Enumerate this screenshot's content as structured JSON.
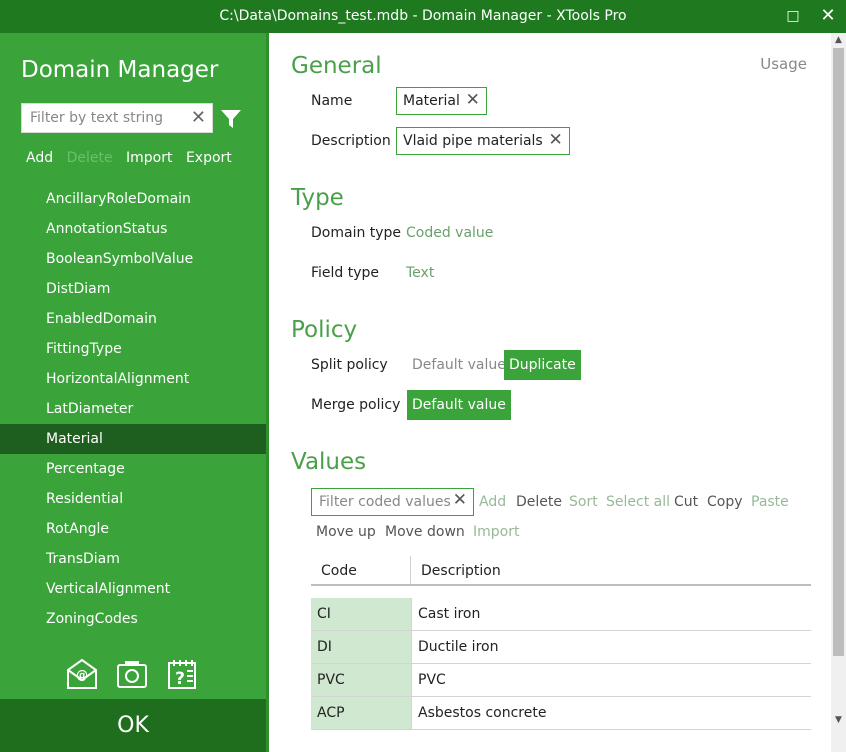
{
  "window": {
    "title": "C:\\Data\\Domains_test.mdb - Domain Manager - XTools Pro",
    "maximize_glyph": "□",
    "close_glyph": "✕"
  },
  "sidebar": {
    "heading": "Domain Manager",
    "filter_placeholder": "Filter by text string",
    "clear_glyph": "✕",
    "actions": {
      "add": "Add",
      "delete": "Delete",
      "import": "Import",
      "export": "Export"
    },
    "domains": [
      "AncillaryRoleDomain",
      "AnnotationStatus",
      "BooleanSymbolValue",
      "DistDiam",
      "EnabledDomain",
      "FittingType",
      "HorizontalAlignment",
      "LatDiameter",
      "Material",
      "Percentage",
      "Residential",
      "RotAngle",
      "TransDiam",
      "VerticalAlignment",
      "ZoningCodes"
    ],
    "selected_domain": "Material",
    "ok_label": "OK"
  },
  "main": {
    "usage_link": "Usage",
    "general": {
      "title": "General",
      "name_label": "Name",
      "name_value": "Material",
      "description_label": "Description",
      "description_value": "Vlaid pipe materials",
      "clear_glyph": "✕"
    },
    "type": {
      "title": "Type",
      "domain_type_label": "Domain type",
      "domain_type_value": "Coded value",
      "field_type_label": "Field type",
      "field_type_value": "Text"
    },
    "policy": {
      "title": "Policy",
      "split_label": "Split policy",
      "split_options": [
        "Default value",
        "Duplicate"
      ],
      "split_selected": "Duplicate",
      "merge_label": "Merge policy",
      "merge_options": [
        "Default value"
      ],
      "merge_selected": "Default value"
    },
    "values": {
      "title": "Values",
      "filter_placeholder": "Filter coded values",
      "actions": {
        "add": "Add",
        "delete": "Delete",
        "sort": "Sort",
        "select_all": "Select all",
        "cut": "Cut",
        "copy": "Copy",
        "paste": "Paste",
        "move_up": "Move up",
        "move_down": "Move down",
        "import": "Import"
      },
      "columns": [
        "Code",
        "Description"
      ],
      "rows": [
        {
          "code": "CI",
          "description": "Cast iron"
        },
        {
          "code": "DI",
          "description": "Ductile iron"
        },
        {
          "code": "PVC",
          "description": "PVC"
        },
        {
          "code": "ACP",
          "description": "Asbestos concrete"
        }
      ]
    }
  },
  "scrollbar": {
    "up_glyph": "▲",
    "down_glyph": "▼"
  },
  "colors": {
    "titlebar": "#1f7a1f",
    "sidebar": "#3aa33a",
    "selected_item": "#1e5e1e",
    "accent": "#4aa04a",
    "code_cell": "#cfe8cf"
  },
  "icons": [
    "filter-icon",
    "email-icon",
    "screenshot-icon",
    "help-icon"
  ]
}
